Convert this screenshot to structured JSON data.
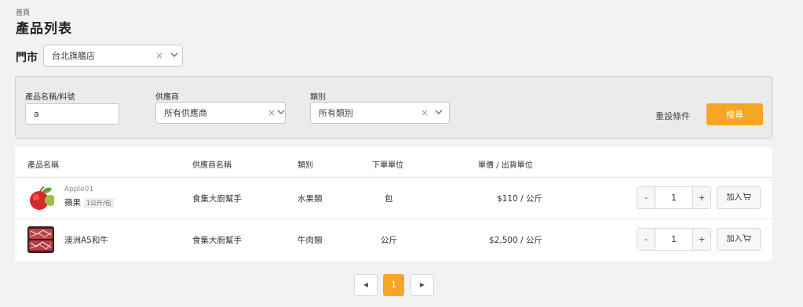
{
  "breadcrumb": "首頁",
  "title": "產品列表",
  "store": {
    "label": "門市",
    "value": "台北旗艦店",
    "clear": "×",
    "chevron": "⌄"
  },
  "filters": {
    "name_label": "產品名稱/料號",
    "name_value": "a",
    "supplier_label": "供應商",
    "supplier_value": "所有供應商",
    "category_label": "類別",
    "category_value": "所有類別",
    "clear": "×",
    "chevron": "⌄",
    "reset_label": "重設條件",
    "search_label": "搜尋"
  },
  "table": {
    "headers": [
      "產品名稱",
      "供應商名稱",
      "類別",
      "下單單位",
      "單價 / 出貨單位"
    ],
    "rows": [
      {
        "sku": "Apple01",
        "name": "蘋果",
        "spec": "1公斤/包",
        "supplier": "食集大廚幫手",
        "category": "水果類",
        "unit": "包",
        "price": "$110 / 公斤",
        "qty": "1",
        "minus": "-",
        "plus": "+",
        "add": "加入",
        "thumb_icon": "apple-icon"
      },
      {
        "sku": "",
        "name": "澳洲A5和牛",
        "spec": "",
        "supplier": "食集大廚幫手",
        "category": "牛肉類",
        "unit": "公斤",
        "price": "$2,500 / 公斤",
        "qty": "1",
        "minus": "-",
        "plus": "+",
        "add": "加入",
        "thumb_icon": "beef-icon"
      }
    ]
  },
  "pagination": {
    "current": "1",
    "prev": "◀",
    "next": "▶"
  },
  "colors": {
    "accent": "#f5a623",
    "background": "#f2f2f2",
    "panel": "#ebebeb"
  }
}
